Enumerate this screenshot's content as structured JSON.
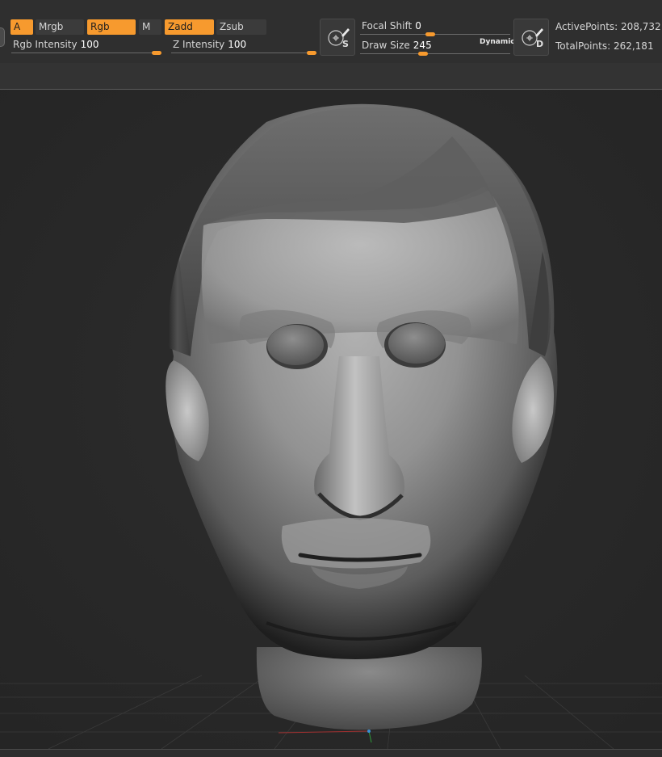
{
  "toolbar": {
    "buttons": {
      "a": {
        "label": "A",
        "active": true
      },
      "mrgb": {
        "label": "Mrgb",
        "active": false
      },
      "rgb": {
        "label": "Rgb",
        "active": true
      },
      "m": {
        "label": "M",
        "active": false
      },
      "zadd": {
        "label": "Zadd",
        "active": true
      },
      "zsub": {
        "label": "Zsub",
        "active": false
      }
    },
    "rgb_intensity": {
      "label": "Rgb Intensity",
      "value": "100",
      "fraction": 1.0
    },
    "z_intensity": {
      "label": "Z Intensity",
      "value": "100",
      "fraction": 1.0
    },
    "focal_shift": {
      "label": "Focal Shift",
      "value": "0",
      "fraction": 0.5
    },
    "draw_size": {
      "label": "Draw Size",
      "value": "245",
      "fraction": 0.45
    },
    "dynamic_label": "Dynamic",
    "stroke_icon_letter": "S",
    "draw_icon_letter": "D",
    "active_points": {
      "label": "ActivePoints:",
      "value": "208,732"
    },
    "total_points": {
      "label": "TotalPoints:",
      "value": "262,181"
    }
  },
  "colors": {
    "accent": "#f79a2e",
    "background": "#2a2a2a",
    "toolbar": "#2f2f2f"
  },
  "viewport": {
    "model": "sculpted-head",
    "grid_floor": true
  }
}
